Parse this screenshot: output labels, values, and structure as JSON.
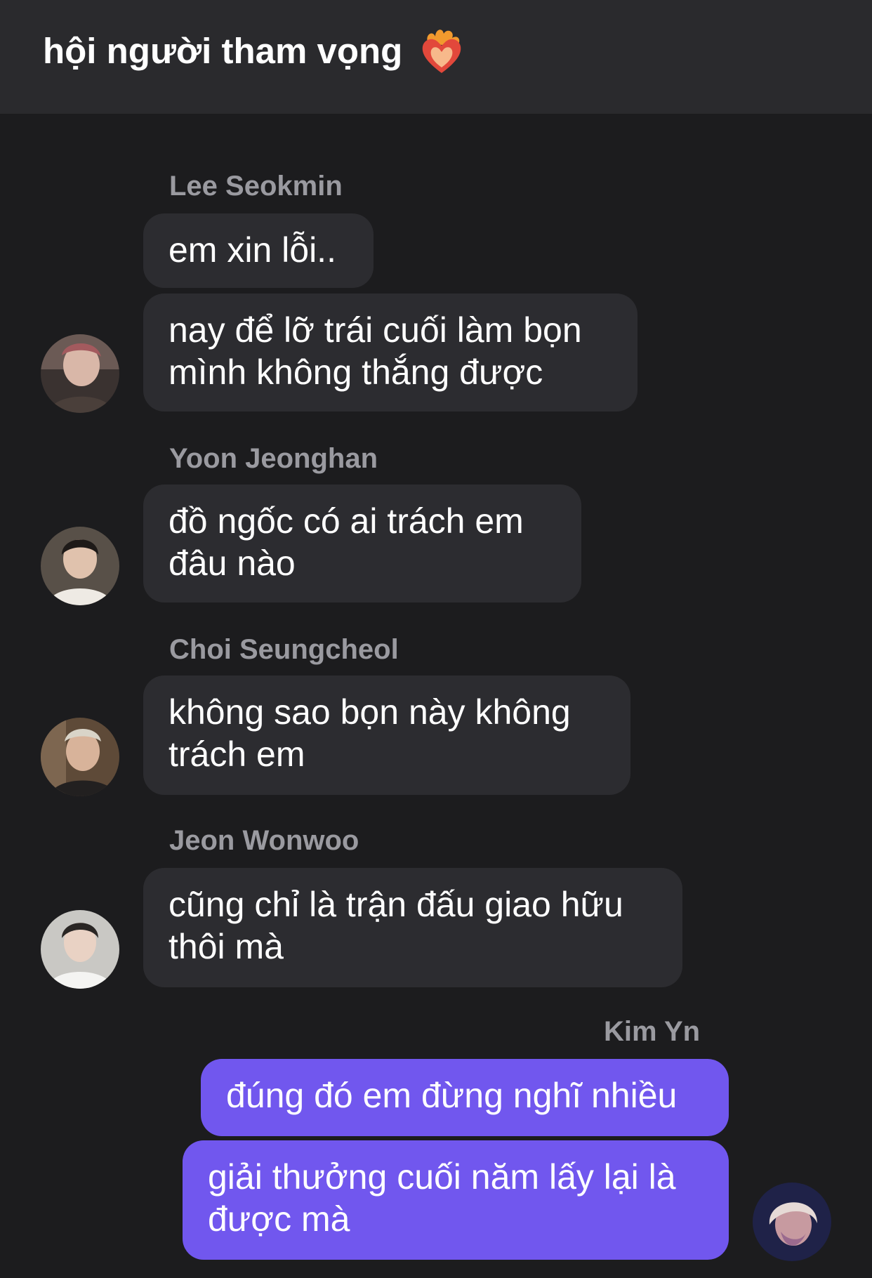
{
  "header": {
    "title": "hội người tham vọng",
    "icon": "heart-on-fire-icon"
  },
  "messages": [
    {
      "sender": "Lee Seokmin",
      "lines": [
        "em xin lỗi.."
      ]
    },
    {
      "lines": [
        "nay để lỡ trái cuối làm bọn",
        "mình không thắng được"
      ]
    },
    {
      "sender": "Yoon Jeonghan",
      "lines": [
        "đồ ngốc có ai trách em",
        "đâu nào"
      ]
    },
    {
      "sender": "Choi Seungcheol",
      "lines": [
        "không sao bọn này không",
        "trách em"
      ]
    },
    {
      "sender": "Jeon Wonwoo",
      "lines": [
        "cũng chỉ là trận đấu giao hữu",
        "thôi mà"
      ]
    },
    {
      "sender": "Kim Yn",
      "lines": [
        "đúng đó em đừng nghĩ nhiều"
      ]
    },
    {
      "lines": [
        "giải thưởng cuối năm lấy lại là",
        "được mà"
      ]
    }
  ],
  "colors": {
    "background": "#1c1c1e",
    "header": "#2a2a2d",
    "incoming_bubble": "#2c2c30",
    "outgoing_bubble": "#7157ee",
    "sender_name": "#9a9aa0"
  }
}
